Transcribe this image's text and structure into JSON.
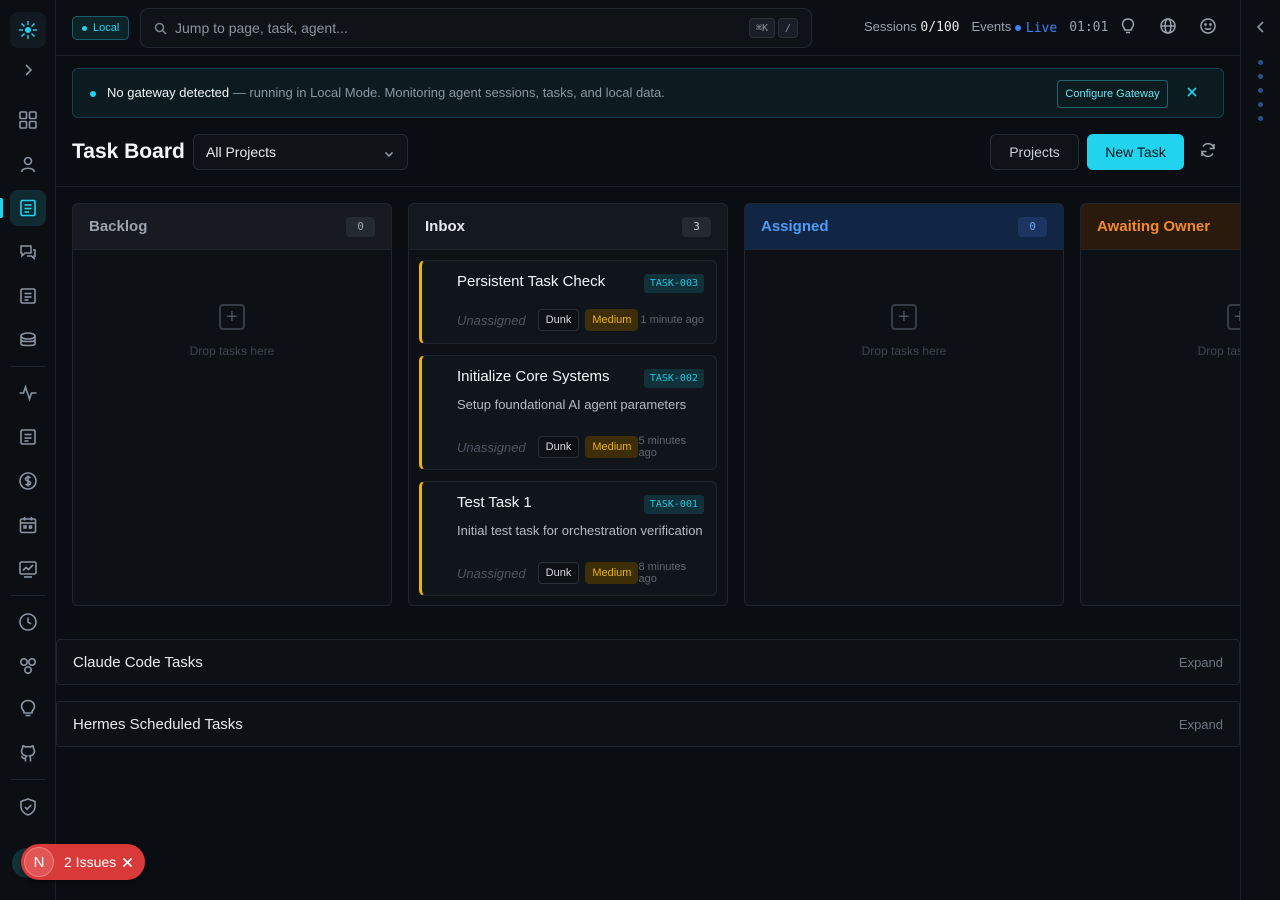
{
  "topbar": {
    "mode_badge": "Local",
    "search_placeholder": "Jump to page, task, agent...",
    "shortcut_keys": [
      "⌘K",
      "/"
    ],
    "sessions_label": "Sessions",
    "sessions_value": "0/100",
    "events_label": "Events",
    "events_status": "Live",
    "clock": "01:01"
  },
  "banner": {
    "headline": "No gateway detected",
    "message": " — running in Local Mode. Monitoring agent sessions, tasks, and local data.",
    "action_label": "Configure Gateway"
  },
  "page": {
    "title": "Task Board",
    "project_filter": "All Projects",
    "projects_button": "Projects",
    "new_task_button": "New Task"
  },
  "columns": [
    {
      "title": "Backlog",
      "count": "0",
      "empty_text": "Drop tasks here"
    },
    {
      "title": "Inbox",
      "count": "3",
      "empty_text": ""
    },
    {
      "title": "Assigned",
      "count": "0",
      "empty_text": "Drop tasks here"
    },
    {
      "title": "Awaiting Owner",
      "count": "",
      "empty_text": "Drop tasks here"
    }
  ],
  "inbox_cards": [
    {
      "title": "Persistent Task Check",
      "id": "TASK-003",
      "description": "",
      "assignee": "Unassigned",
      "owner": "Dunk",
      "priority": "Medium",
      "updated": "1 minute ago"
    },
    {
      "title": "Initialize Core Systems",
      "id": "TASK-002",
      "description": "Setup foundational AI agent parameters",
      "assignee": "Unassigned",
      "owner": "Dunk",
      "priority": "Medium",
      "updated": "5 minutes ago"
    },
    {
      "title": "Test Task 1",
      "id": "TASK-001",
      "description": "Initial test task for orchestration verification",
      "assignee": "Unassigned",
      "owner": "Dunk",
      "priority": "Medium",
      "updated": "8 minutes ago"
    }
  ],
  "sections": [
    {
      "title": "Claude Code Tasks",
      "action": "Expand"
    },
    {
      "title": "Hermes Scheduled Tasks",
      "action": "Expand"
    }
  ],
  "issues": {
    "badge": "N",
    "label": "2 Issues"
  },
  "colors": {
    "accent": "#22d3ee",
    "priority_medium": "#eab308",
    "assigned": "#4f9cf5",
    "awaiting": "#f08a2c",
    "issues": "#d83a3a"
  },
  "rail_icons": [
    "logo-icon",
    "expand-icon",
    "dashboard-icon",
    "user-icon",
    "tasks-icon",
    "chat-icon",
    "logs-icon",
    "database-icon",
    "activity-icon",
    "notes-icon",
    "billing-icon",
    "calendar-icon",
    "analytics-icon",
    "clock-icon",
    "integrations-icon",
    "ideas-icon",
    "github-icon",
    "security-icon"
  ]
}
